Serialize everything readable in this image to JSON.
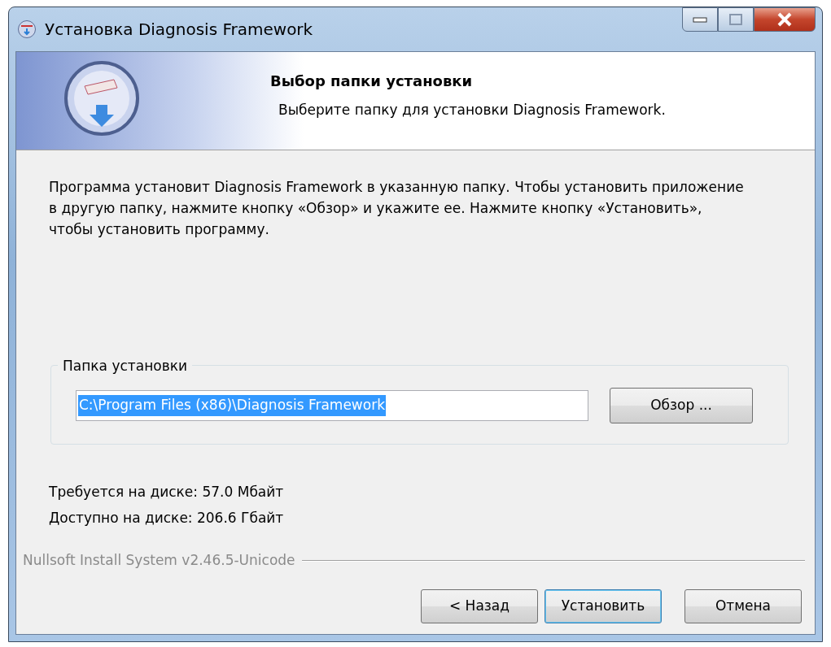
{
  "window": {
    "title": "Установка Diagnosis Framework"
  },
  "header": {
    "title": "Выбор папки установки",
    "subtitle": "Выберите папку для установки Diagnosis Framework."
  },
  "intro": "Программа установит Diagnosis Framework в указанную папку. Чтобы установить приложение в другую папку, нажмите кнопку «Обзор» и укажите ее. Нажмите кнопку «Установить», чтобы установить программу.",
  "folder_group": {
    "label": "Папка установки",
    "path": "C:\\Program Files (x86)\\Diagnosis Framework",
    "path_selected": true,
    "browse_button": "Обзор ..."
  },
  "space": [
    "Требуется на диске: 57.0 Мбайт",
    "Доступно на диске: 206.6 Гбайт"
  ],
  "branding": "Nullsoft Install System v2.46.5-Unicode",
  "buttons": [
    {
      "label": "< Назад",
      "default": false
    },
    {
      "label": "Установить",
      "default": true
    },
    {
      "label": "Отмена",
      "default": false
    }
  ]
}
